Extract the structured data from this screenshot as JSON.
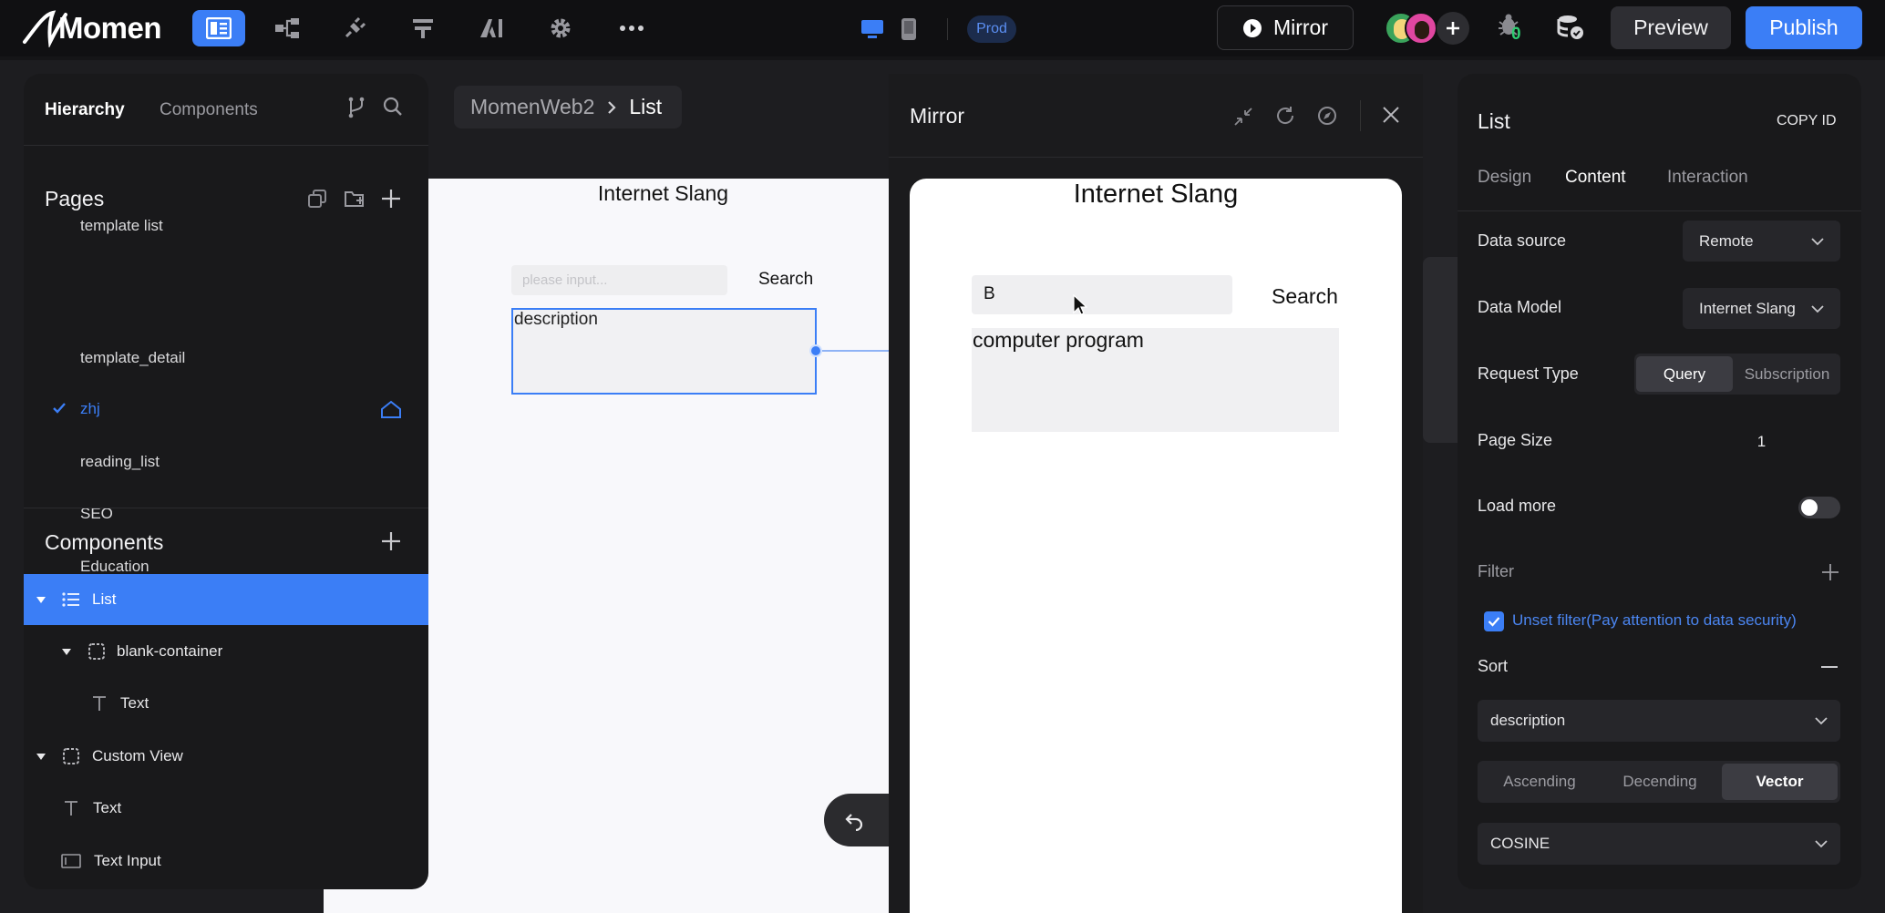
{
  "app": {
    "logo_text": "Momen"
  },
  "topbar": {
    "env_badge": "Prod",
    "mirror_label": "Mirror",
    "preview_label": "Preview",
    "publish_label": "Publish",
    "debug_count": "0",
    "icons": [
      "pages-icon",
      "tree-icon",
      "plugin-icon",
      "actionflow-icon",
      "ai-icon",
      "settings-icon",
      "more-icon",
      "desktop-icon",
      "mobile-icon",
      "play-icon",
      "collaborators-avatars",
      "add-user-icon",
      "bug-icon",
      "database-icon"
    ]
  },
  "left": {
    "tab_hierarchy": "Hierarchy",
    "tab_components": "Components",
    "pages_title": "Pages",
    "pages": [
      {
        "label": "template list"
      },
      {
        "label": "template_detail"
      },
      {
        "label": "zhj"
      },
      {
        "label": "reading_list"
      },
      {
        "label": "SEO"
      },
      {
        "label": "Education"
      }
    ],
    "components_title": "Components",
    "tree": [
      {
        "label": "List",
        "icon": "list-icon"
      },
      {
        "label": "blank-container",
        "icon": "container-icon"
      },
      {
        "label": "Text",
        "icon": "text-icon"
      },
      {
        "label": "Custom View",
        "icon": "container-icon"
      },
      {
        "label": "Text",
        "icon": "text-icon"
      },
      {
        "label": "Text Input",
        "icon": "text-input-icon"
      }
    ]
  },
  "breadcrumb": {
    "root": "MomenWeb2",
    "current": "List"
  },
  "canvas": {
    "title": "Internet Slang",
    "input_placeholder": "please input...",
    "search_label": "Search",
    "description_label": "description"
  },
  "mirror": {
    "title": "Mirror",
    "page_title": "Internet Slang",
    "input_value": "B",
    "search_label": "Search",
    "result_text": "computer program"
  },
  "right": {
    "component_name": "List",
    "copy_id": "COPY ID",
    "tabs": {
      "design": "Design",
      "content": "Content",
      "interaction": "Interaction"
    },
    "active_tab": "Content",
    "data_source_label": "Data source",
    "data_source_value": "Remote",
    "data_model_label": "Data Model",
    "data_model_value": "Internet Slang",
    "request_type_label": "Request Type",
    "request_query": "Query",
    "request_subscription": "Subscription",
    "page_size_label": "Page Size",
    "page_size_value": "1",
    "load_more_label": "Load more",
    "load_more_on": false,
    "filter_label": "Filter",
    "unset_filter_label": "Unset filter(Pay attention to data security)",
    "unset_filter_checked": true,
    "sort_label": "Sort",
    "sort_field": "description",
    "sort_ascending": "Ascending",
    "sort_descending": "Decending",
    "sort_vector": "Vector",
    "sort_active": "Vector",
    "metric_value": "COSINE"
  },
  "colors": {
    "accent": "#3b7ef6",
    "topbar": "#101012",
    "panel": "#19191b"
  }
}
